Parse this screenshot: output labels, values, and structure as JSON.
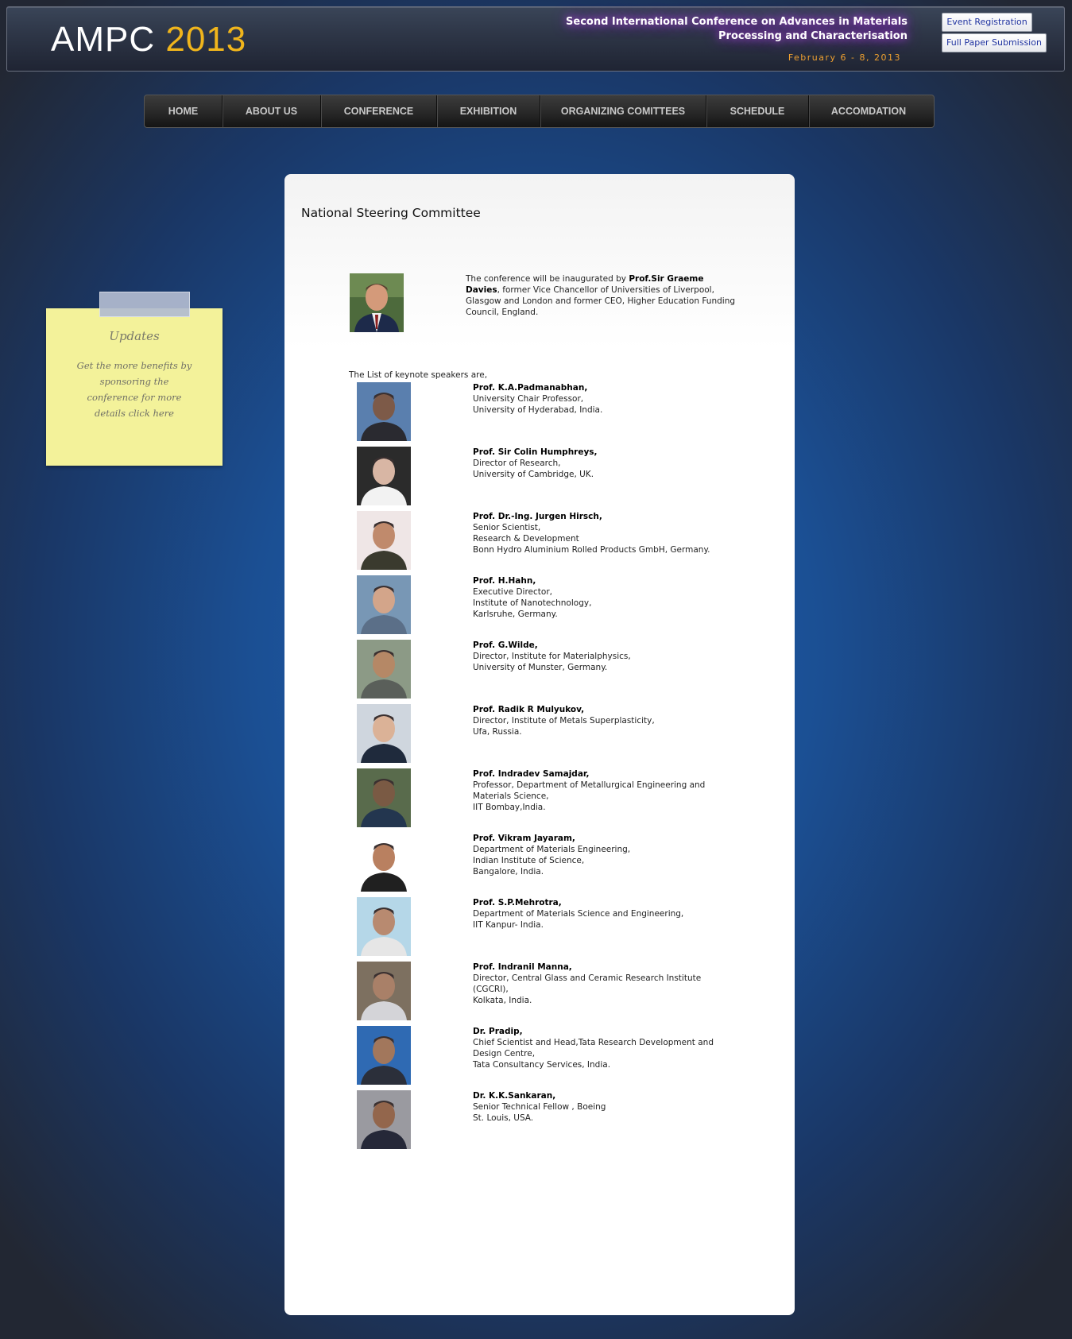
{
  "header": {
    "logo_text": "AMPC",
    "logo_year": "2013",
    "conference_title_line1": "Second International Conference on Advances in Materials",
    "conference_title_line2": "Processing and Characterisation",
    "dates": "February 6 - 8, 2013",
    "buttons": {
      "event_registration": "Event Registration",
      "full_paper_submission": "Full Paper Submission"
    }
  },
  "nav": {
    "items": [
      {
        "label": "HOME"
      },
      {
        "label": "ABOUT US"
      },
      {
        "label": "CONFERENCE"
      },
      {
        "label": "EXHIBITION"
      },
      {
        "label": "ORGANIZING COMITTEES"
      },
      {
        "label": "SCHEDULE"
      },
      {
        "label": "ACCOMDATION"
      }
    ]
  },
  "updates": {
    "title": "Updates",
    "text": "Get the more benefits by sponsoring the conference for more details click here"
  },
  "main": {
    "title": "National Steering Committee",
    "intro": {
      "before": "The conference will be inaugurated by ",
      "bold": "Prof.Sir Graeme Davies",
      "after": ", former Vice Chancellor of Universities of Liverpool, Glasgow and London and former CEO, Higher Education Funding Council, England."
    },
    "list_label": "The List of keynote speakers are,",
    "speakers": [
      {
        "name": "Prof. K.A.Padmanabhan,",
        "lines": [
          "University Chair Professor,",
          "University of Hyderabad, India."
        ]
      },
      {
        "name": "Prof. Sir Colin Humphreys,",
        "lines": [
          "Director of Research,",
          "University of Cambridge, UK."
        ]
      },
      {
        "name": "Prof. Dr.-Ing. Jurgen Hirsch,",
        "lines": [
          "Senior Scientist,",
          "Research & Development",
          "Bonn Hydro Aluminium Rolled Products GmbH, Germany."
        ]
      },
      {
        "name": "Prof. H.Hahn,",
        "lines": [
          "Executive Director,",
          "Institute of Nanotechnology,",
          "Karlsruhe, Germany."
        ]
      },
      {
        "name": "Prof. G.Wilde,",
        "lines": [
          "Director, Institute for Materialphysics,",
          "University of Munster, Germany."
        ]
      },
      {
        "name": "Prof. Radik R Mulyukov,",
        "lines": [
          "Director, Institute of Metals Superplasticity,",
          "Ufa, Russia."
        ]
      },
      {
        "name": "Prof. Indradev Samajdar,",
        "lines": [
          "Professor, Department of Metallurgical Engineering and Materials Science,",
          "IIT Bombay,India."
        ]
      },
      {
        "name": "Prof. Vikram Jayaram,",
        "lines": [
          "Department of Materials Engineering,",
          "Indian Institute of Science,",
          "Bangalore, India."
        ]
      },
      {
        "name": "Prof. S.P.Mehrotra,",
        "lines": [
          "Department of Materials Science and Engineering,",
          "IIT Kanpur- India."
        ]
      },
      {
        "name": "Prof. Indranil Manna,",
        "lines": [
          "Director, Central Glass and Ceramic Research Institute (CGCRI),",
          "Kolkata, India."
        ]
      },
      {
        "name": "Dr. Pradip,",
        "lines": [
          "Chief Scientist and Head,Tata Research Development and Design Centre,",
          "Tata Consultancy Services, India."
        ]
      },
      {
        "name": "Dr. K.K.Sankaran,",
        "lines": [
          "Senior Technical Fellow , Boeing",
          "St. Louis, USA."
        ]
      }
    ]
  }
}
